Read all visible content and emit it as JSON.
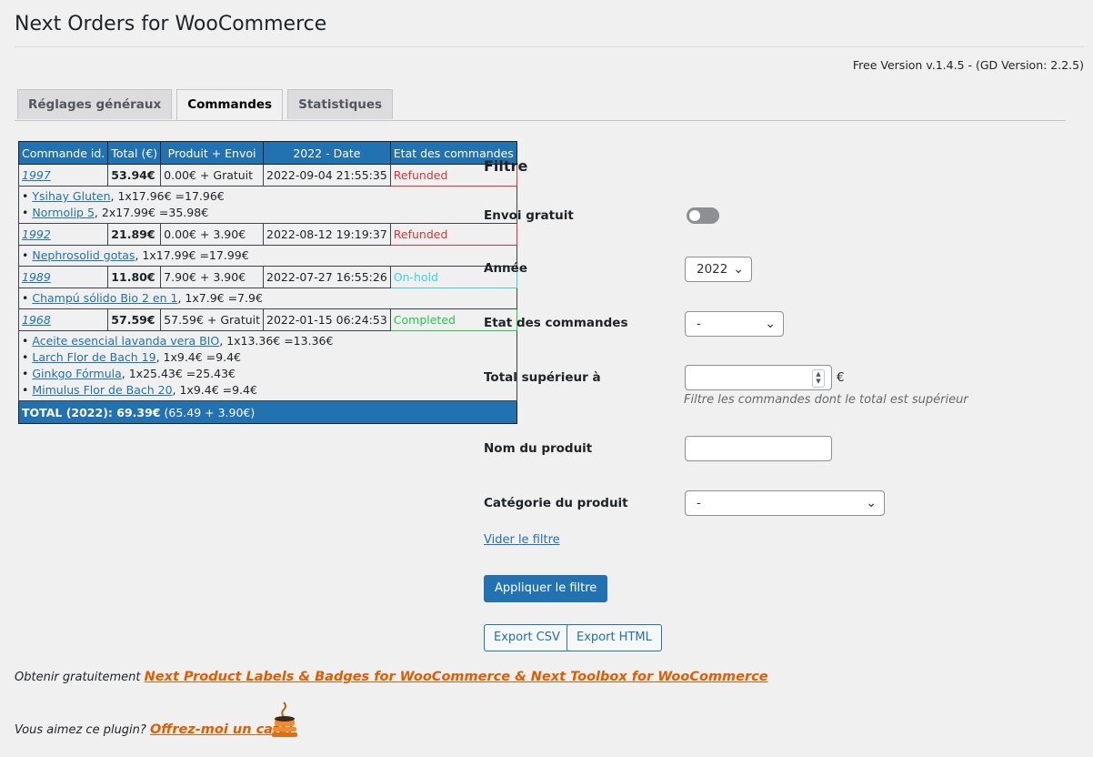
{
  "page": {
    "title": "Next Orders for WooCommerce",
    "version": "Free Version v.1.4.5 - (GD Version: 2.2.5)"
  },
  "tabs": [
    {
      "label": "Réglages généraux",
      "active": false
    },
    {
      "label": "Commandes",
      "active": true
    },
    {
      "label": "Statistiques",
      "active": false
    }
  ],
  "orders_table": {
    "headers": [
      "Commande id.",
      "Total (€)",
      "Produit + Envoi",
      "2022 - Date",
      "Etat des commandes"
    ],
    "orders": [
      {
        "id": "1997",
        "total": "53.94€",
        "product_shipping": "0.00€ + Gratuit",
        "date": "2022-09-04 21:55:35",
        "status": "Refunded",
        "status_color": "#d63638",
        "items": [
          {
            "name": "Ysihay Gluten",
            "detail": ", 1x17.96€ =17.96€"
          },
          {
            "name": "Normolip 5",
            "detail": ", 2x17.99€ =35.98€"
          }
        ]
      },
      {
        "id": "1992",
        "total": "21.89€",
        "product_shipping": "0.00€ + 3.90€",
        "date": "2022-08-12 19:19:37",
        "status": "Refunded",
        "status_color": "#d63638",
        "items": [
          {
            "name": "Nephrosolid gotas",
            "detail": ", 1x17.99€ =17.99€"
          }
        ]
      },
      {
        "id": "1989",
        "total": "11.80€",
        "product_shipping": "7.90€ + 3.90€",
        "date": "2022-07-27 16:55:26",
        "status": "On-hold",
        "status_color": "#33d6e0",
        "items": [
          {
            "name": "Champú sólido Bio 2 en 1",
            "detail": ", 1x7.9€ =7.9€"
          }
        ]
      },
      {
        "id": "1968",
        "total": "57.59€",
        "product_shipping": "57.59€ + Gratuit",
        "date": "2022-01-15 06:24:53",
        "status": "Completed",
        "status_color": "#22c84a",
        "items": [
          {
            "name": "Aceite esencial lavanda vera BIO",
            "detail": ", 1x13.36€ =13.36€"
          },
          {
            "name": "Larch Flor de Bach 19",
            "detail": ", 1x9.4€ =9.4€"
          },
          {
            "name": "Ginkgo Fórmula",
            "detail": ", 1x25.43€ =25.43€"
          },
          {
            "name": "Mimulus Flor de Bach 20",
            "detail": ", 1x9.4€ =9.4€"
          }
        ]
      }
    ],
    "total_label": "TOTAL (2022): 69.39€",
    "total_breakdown": " (65.49 + 3.90€)"
  },
  "filter": {
    "title": "Filtre",
    "free_shipping_label": "Envoi gratuit",
    "free_shipping_on": false,
    "year_label": "Année",
    "year_value": "2022",
    "status_label": "Etat des commandes",
    "status_value": "-",
    "total_above_label": "Total supérieur à",
    "total_above_value": "",
    "currency": "€",
    "total_above_hint": "Filtre les commandes dont le total est supérieur",
    "product_name_label": "Nom du produit",
    "product_name_value": "",
    "category_label": "Catégorie du produit",
    "category_value": "-",
    "clear_link": "Vider le filtre",
    "apply_button": "Appliquer le filtre",
    "export_csv": "Export CSV",
    "export_html": "Export HTML"
  },
  "footer": {
    "promo_prefix": "Obtenir gratuitement ",
    "promo_link": "Next Product Labels & Badges for WooCommerce & Next Toolbox for WooCommerce",
    "coffee_prefix": "Vous aimez ce plugin? ",
    "coffee_link": "Offrez-moi un café!"
  },
  "colors": {
    "accent": "#2271b1",
    "promo": "#e55b00",
    "background": "#f0f0f1"
  },
  "icons": [
    "chevron-down-icon",
    "coffee-cup-icon",
    "spinner-arrows-icon"
  ]
}
